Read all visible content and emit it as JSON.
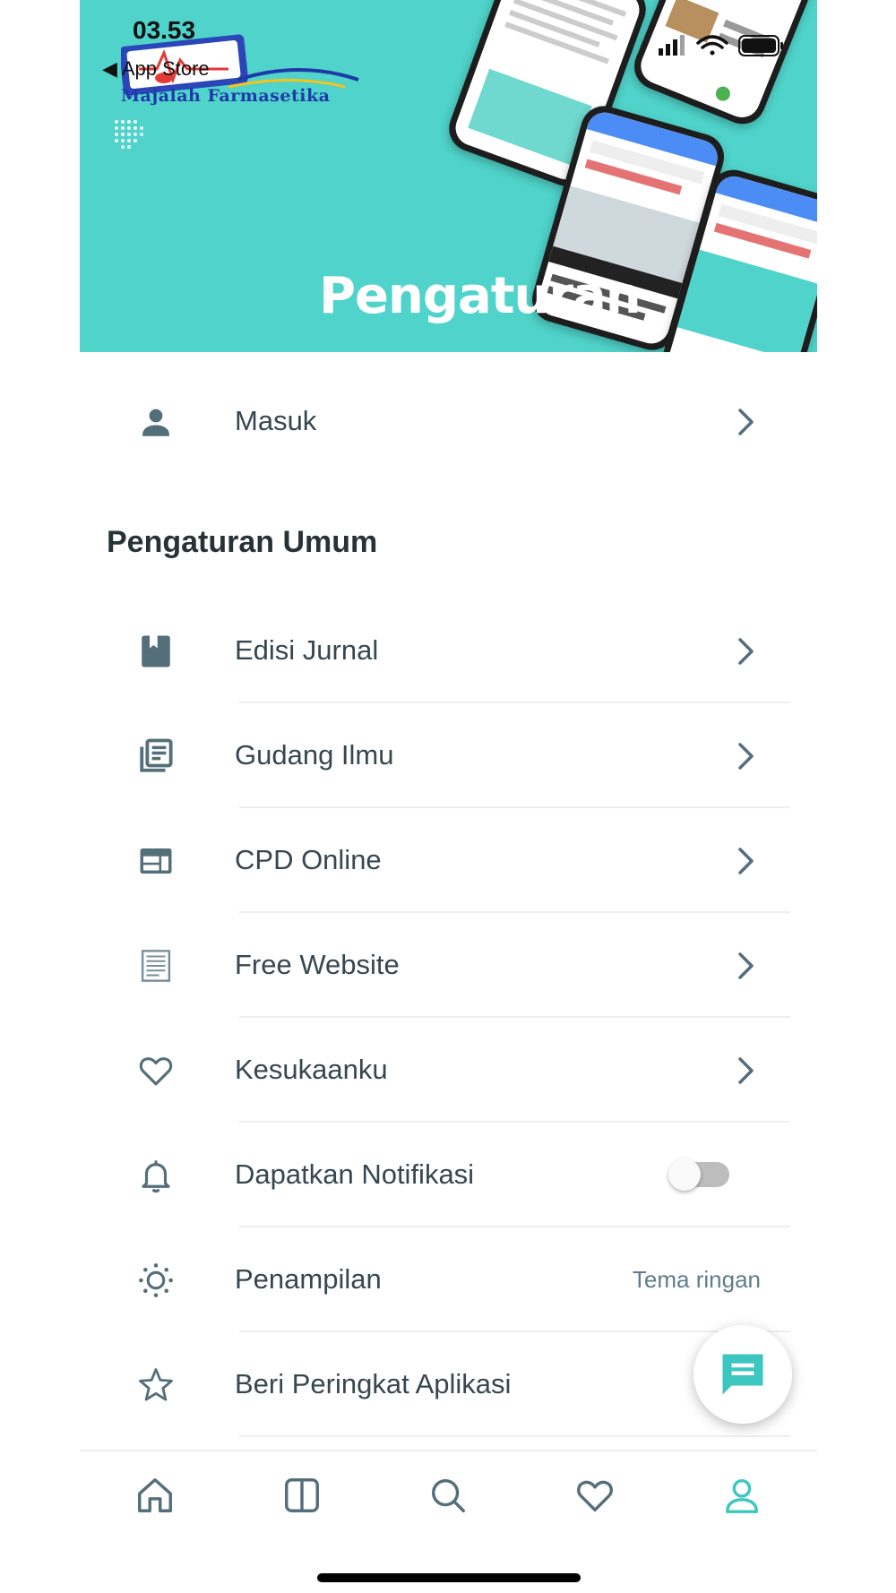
{
  "status_bar": {
    "time": "03.53",
    "back_app": "◀ App Store"
  },
  "banner": {
    "logo_text": "Majalah Farmasetika",
    "title": "Pengaturan"
  },
  "login": {
    "label": "Masuk",
    "icon": "person-icon"
  },
  "general_settings": {
    "title": "Pengaturan Umum",
    "items": [
      {
        "label": "Edisi Jurnal",
        "icon": "book-icon"
      },
      {
        "label": "Gudang Ilmu",
        "icon": "library-books-icon"
      },
      {
        "label": "CPD Online",
        "icon": "web-icon"
      },
      {
        "label": "Free Website",
        "icon": "article-icon"
      },
      {
        "label": "Kesukaanku",
        "icon": "heart-icon"
      },
      {
        "label": "Dapatkan Notifikasi",
        "icon": "bell-icon",
        "toggle_on": false
      },
      {
        "label": "Penampilan",
        "icon": "sun-icon",
        "value": "Tema ringan"
      },
      {
        "label": "Beri Peringkat Aplikasi",
        "icon": "star-icon"
      }
    ]
  },
  "fab": {
    "icon": "chat-icon"
  },
  "bottom_nav": [
    {
      "name": "home",
      "icon": "home-icon",
      "active": false
    },
    {
      "name": "edition",
      "icon": "book-open-icon",
      "active": false
    },
    {
      "name": "search",
      "icon": "search-icon",
      "active": false
    },
    {
      "name": "favorites",
      "icon": "heart-icon",
      "active": false
    },
    {
      "name": "profile",
      "icon": "profile-icon",
      "active": true
    }
  ],
  "colors": {
    "accent": "#4fd3ca",
    "icon": "#546e7a",
    "text": "#37474f",
    "active_nav": "#3cc6c0"
  }
}
